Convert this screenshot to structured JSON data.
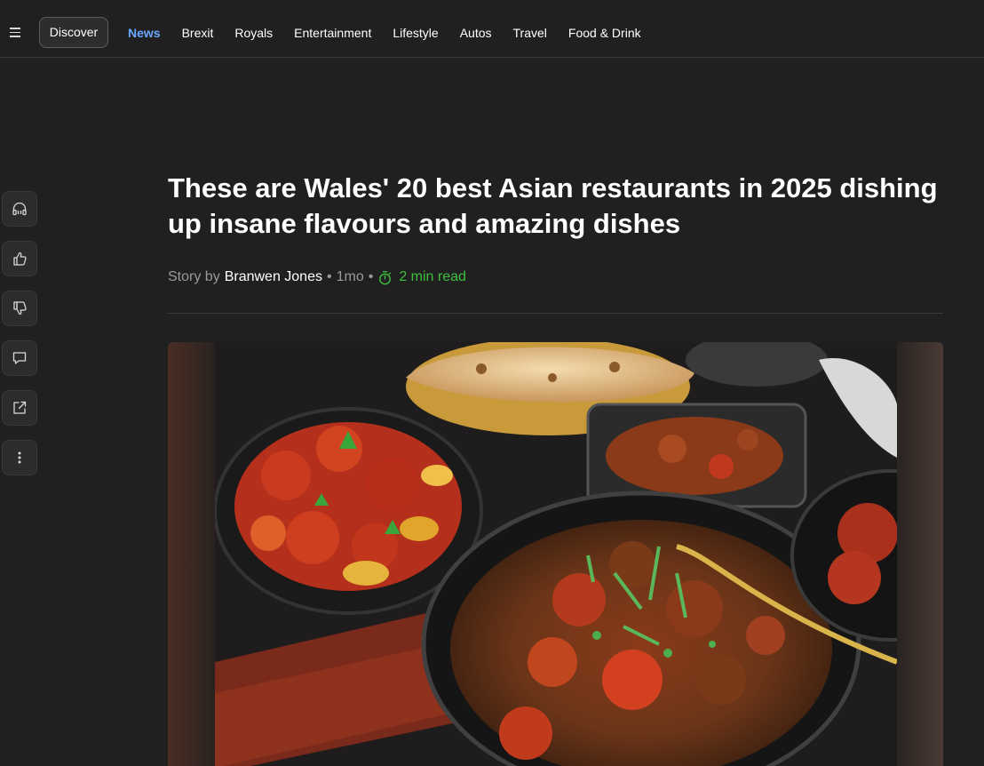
{
  "nav": {
    "menu_icon": "hamburger-menu-icon",
    "discover_label": "Discover",
    "links": [
      "News",
      "Brexit",
      "Royals",
      "Entertainment",
      "Lifestyle",
      "Autos",
      "Travel",
      "Food & Drink"
    ],
    "active_link": "News",
    "active_color": "#6aa8ff"
  },
  "rail": {
    "icons": [
      "headphones-icon",
      "thumbs-up-icon",
      "thumbs-down-icon",
      "comment-icon",
      "share-icon",
      "more-vertical-icon"
    ]
  },
  "article": {
    "headline": "These are Wales' 20 best Asian restaurants in 2025 dishing up insane flavours and amazing dishes",
    "story_by": "Story by",
    "author": "Branwen Jones",
    "age": "1mo",
    "read_time": "2 min read",
    "read_time_color": "#3fbf3f",
    "timer_icon": "stopwatch-icon"
  }
}
